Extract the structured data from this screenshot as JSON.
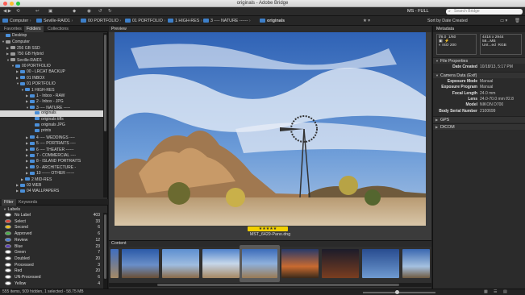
{
  "window": {
    "title": "originals - Adobe Bridge"
  },
  "toolbar": {
    "workspace": "MS - FULL",
    "search_placeholder": "Search Bridge",
    "sort_label": "Sort by Date Created"
  },
  "path": {
    "crumbs": [
      "Computer",
      "Seville-RAID1",
      "00 PORTFOLIO",
      "01 PORTFOLIO",
      "1 HIGH-RES",
      "3 ---- NATURE ------",
      "originals"
    ]
  },
  "left_tabs": [
    "Favorites",
    "Folders",
    "Collections"
  ],
  "tree": [
    {
      "label": "Desktop",
      "indent": 0,
      "kind": "folder",
      "tri": ""
    },
    {
      "label": "Computer",
      "indent": 0,
      "kind": "disk",
      "tri": "▼"
    },
    {
      "label": "256 GB SSD",
      "indent": 1,
      "kind": "disk",
      "tri": "▶"
    },
    {
      "label": "750 GB Hybrid",
      "indent": 1,
      "kind": "disk",
      "tri": "▶"
    },
    {
      "label": "Seville-RAID1",
      "indent": 1,
      "kind": "disk",
      "tri": "▼"
    },
    {
      "label": "00 PORTFOLIO",
      "indent": 2,
      "kind": "folder",
      "tri": "▼"
    },
    {
      "label": "00 - LRCAT BACKUP",
      "indent": 3,
      "kind": "folder",
      "tri": "▶"
    },
    {
      "label": "01 INBOX",
      "indent": 3,
      "kind": "folder",
      "tri": "▶"
    },
    {
      "label": "01 PORTFOLIO",
      "indent": 3,
      "kind": "folder",
      "tri": "▼"
    },
    {
      "label": "1 HIGH-RES",
      "indent": 4,
      "kind": "folder",
      "tri": "▼"
    },
    {
      "label": "1 - Inbox - RAW",
      "indent": 5,
      "kind": "folder",
      "tri": "▶"
    },
    {
      "label": "2 - Inbox - JPG",
      "indent": 5,
      "kind": "folder",
      "tri": "▶"
    },
    {
      "label": "3 ---- NATURE -----",
      "indent": 5,
      "kind": "folder",
      "tri": "▼"
    },
    {
      "label": "originals",
      "indent": 6,
      "kind": "folder",
      "tri": "",
      "selected": true
    },
    {
      "label": "originals tiffs",
      "indent": 6,
      "kind": "folder",
      "tri": ""
    },
    {
      "label": "originals JPG",
      "indent": 6,
      "kind": "folder",
      "tri": ""
    },
    {
      "label": "prints",
      "indent": 6,
      "kind": "folder",
      "tri": ""
    },
    {
      "label": "4 ---- WEDDINGS ----",
      "indent": 5,
      "kind": "folder",
      "tri": "▶"
    },
    {
      "label": "5 ---- PORTRAITS ----",
      "indent": 5,
      "kind": "folder",
      "tri": "▶"
    },
    {
      "label": "6 ---- THEATER ------",
      "indent": 5,
      "kind": "folder",
      "tri": "▶"
    },
    {
      "label": "7 - COMMERCIAL ----",
      "indent": 5,
      "kind": "folder",
      "tri": "▶"
    },
    {
      "label": "8 - ISLAND PORTRAITS",
      "indent": 5,
      "kind": "folder",
      "tri": "▶"
    },
    {
      "label": "9 - ARCHITECTURE -",
      "indent": 5,
      "kind": "folder",
      "tri": "▶"
    },
    {
      "label": "10 ------ OTHER ------",
      "indent": 5,
      "kind": "folder",
      "tri": "▶"
    },
    {
      "label": "2 MID-RES",
      "indent": 4,
      "kind": "folder",
      "tri": "▶"
    },
    {
      "label": "03 WEB",
      "indent": 3,
      "kind": "folder",
      "tri": "▶"
    },
    {
      "label": "04 WALLPAPERS",
      "indent": 3,
      "kind": "folder",
      "tri": "▶"
    }
  ],
  "filter_tabs": [
    "Filter",
    "Keywords"
  ],
  "labels_header": "Labels",
  "labels": [
    {
      "label": "No Label",
      "count": "403",
      "color": "#ffffff"
    },
    {
      "label": "Select",
      "count": "33",
      "color": "#e24a3a"
    },
    {
      "label": "Second",
      "count": "6",
      "color": "#f0c419"
    },
    {
      "label": "Approved",
      "count": "6",
      "color": "#4cb04c"
    },
    {
      "label": "Review",
      "count": "12",
      "color": "#4a7fd8"
    },
    {
      "label": "Blue",
      "count": "23",
      "color": "#5b3fb8"
    },
    {
      "label": "Green",
      "count": "7",
      "color": "#ffffff"
    },
    {
      "label": "Doubled",
      "count": "20",
      "color": "#ffffff"
    },
    {
      "label": "Processed",
      "count": "3",
      "color": "#ffffff"
    },
    {
      "label": "Red",
      "count": "20",
      "color": "#ffffff"
    },
    {
      "label": "UN-Processed",
      "count": "6",
      "color": "#ffffff"
    },
    {
      "label": "Yellow",
      "count": "4",
      "color": "#ffffff"
    }
  ],
  "preview": {
    "title": "Preview",
    "filename": "MST_6429-Pano.dng",
    "stars": "★★★★★"
  },
  "content": {
    "title": "Content"
  },
  "metadata": {
    "title": "Metadata",
    "camera": {
      "aperture": "f/8.0",
      "shutter": "1/60",
      "iso_label": "ISO 200",
      "size": "4416 x 2944",
      "file_size": "58...MB",
      "resolution": "Unt...ed",
      "color_mode": "RGB"
    },
    "sections": [
      "File Properties",
      "Camera Data (Exif)",
      "GPS",
      "DICOM"
    ],
    "file_properties": [
      {
        "k": "Date Created",
        "v": "10/18/13, 5:17 PM"
      }
    ],
    "exif": [
      {
        "k": "Exposure Mode",
        "v": "Manual"
      },
      {
        "k": "Exposure Program",
        "v": "Manual"
      },
      {
        "k": "Focal Length",
        "v": "24.0 mm"
      },
      {
        "k": "Lens",
        "v": "24.0-70.0 mm f/2.8"
      },
      {
        "k": "Model",
        "v": "NIKON D700"
      },
      {
        "k": "Body Serial Number",
        "v": "2100699"
      }
    ]
  },
  "status": {
    "text": "555 items, 509 hidden, 1 selected - 58.75 MB"
  },
  "colors": {
    "accent": "#3d7fc9",
    "selection": "#d8d8d8",
    "stars": "#f2d000"
  }
}
